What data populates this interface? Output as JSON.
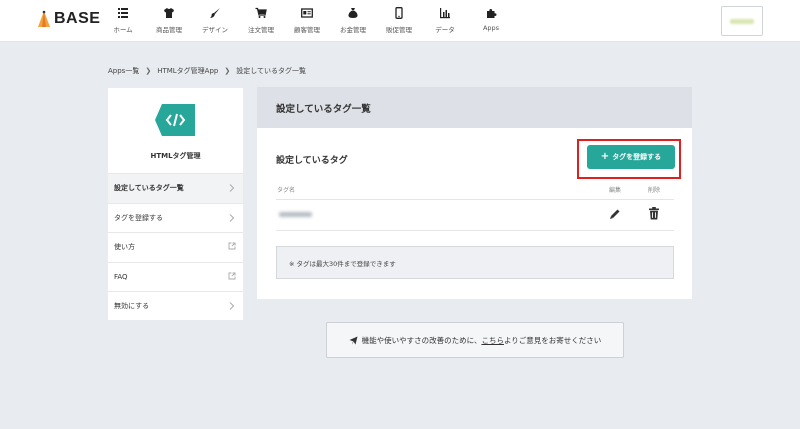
{
  "header": {
    "logo_text": "BASE",
    "nav": [
      {
        "label": "ホーム",
        "icon": "list-icon"
      },
      {
        "label": "商品管理",
        "icon": "tshirt-icon"
      },
      {
        "label": "デザイン",
        "icon": "brush-icon"
      },
      {
        "label": "注文管理",
        "icon": "cart-icon"
      },
      {
        "label": "顧客管理",
        "icon": "id-card-icon"
      },
      {
        "label": "お金管理",
        "icon": "money-bag-icon"
      },
      {
        "label": "販促管理",
        "icon": "phone-icon"
      },
      {
        "label": "データ",
        "icon": "bar-chart-icon"
      },
      {
        "label": "Apps",
        "icon": "puzzle-icon"
      }
    ]
  },
  "breadcrumb": [
    "Apps一覧",
    "HTMLタグ管理App",
    "設定しているタグ一覧"
  ],
  "sidebar": {
    "app_name": "HTMLタグ管理",
    "items": [
      {
        "label": "設定しているタグ一覧"
      },
      {
        "label": "タグを登録する"
      },
      {
        "label": "使い方"
      },
      {
        "label": "FAQ"
      },
      {
        "label": "無効にする"
      }
    ]
  },
  "main": {
    "panel_title": "設定しているタグ一覧",
    "section_title": "設定しているタグ",
    "register_button": "タグを登録する",
    "columns": {
      "name": "タグ名",
      "edit": "編集",
      "delete": "削除"
    },
    "note": "※ タグは最大30件まで登録できます"
  },
  "feedback": {
    "before": "機能や使いやすさの改善のために、",
    "link": "こちら",
    "after": "よりご意見をお寄せください"
  },
  "colors": {
    "accent": "#27a69a",
    "highlight": "#e02020",
    "page_bg": "#e8ebef"
  }
}
